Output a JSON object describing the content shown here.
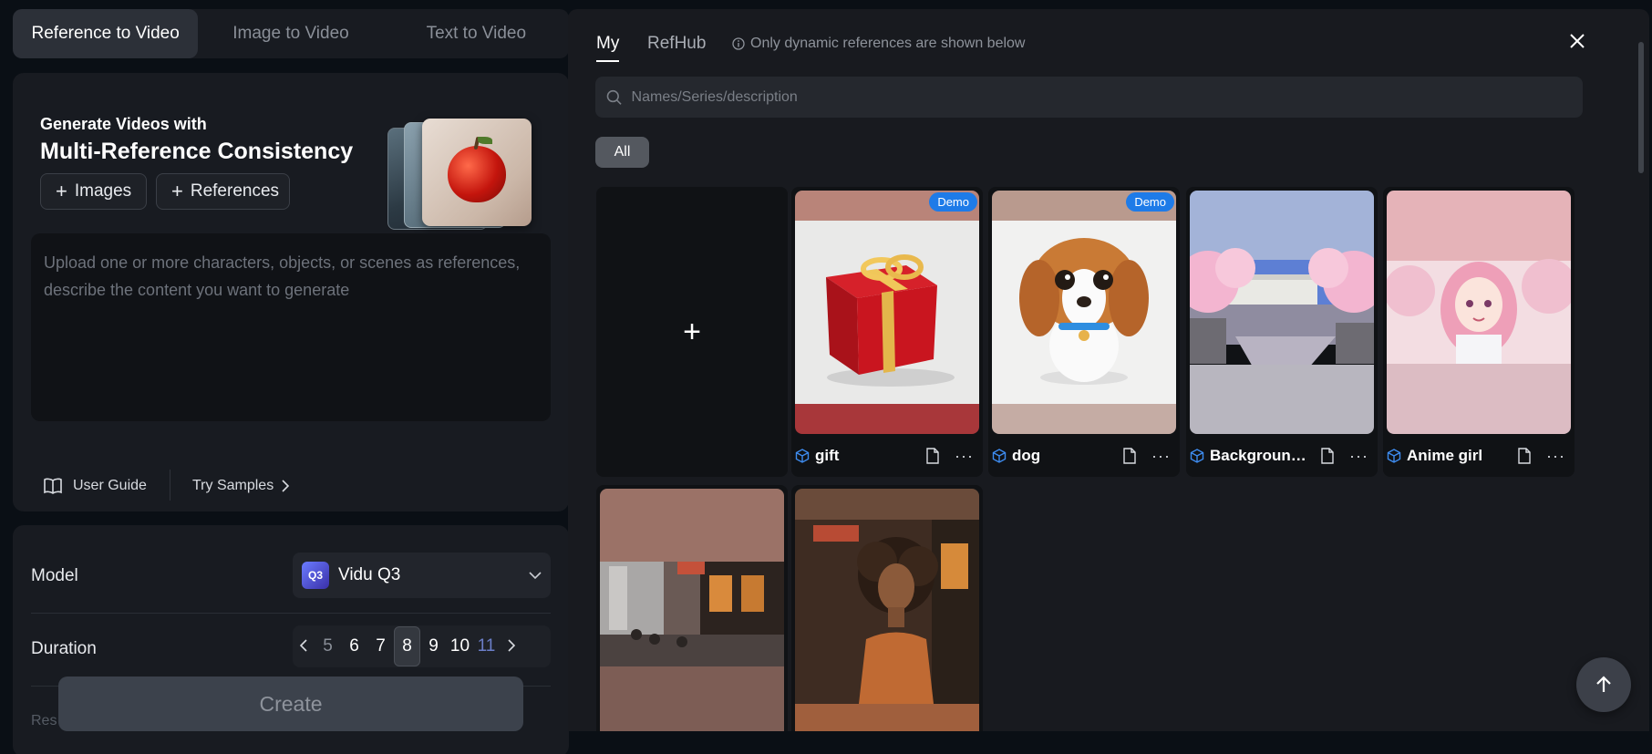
{
  "mode_tabs": [
    {
      "label": "Reference to Video",
      "active": true
    },
    {
      "label": "Image to Video",
      "active": false
    },
    {
      "label": "Text to Video",
      "active": false
    }
  ],
  "promo": {
    "subtitle": "Generate Videos with",
    "title": "Multi-Reference Consistency",
    "images_button": "Images",
    "references_button": "References"
  },
  "prompt": {
    "placeholder": "Upload one or more characters, objects, or scenes as references, describe the content you want to generate"
  },
  "links": {
    "user_guide": "User Guide",
    "try_samples": "Try Samples"
  },
  "settings": {
    "model_label": "Model",
    "model_badge": "Q3",
    "model_value": "Vidu Q3",
    "duration_label": "Duration",
    "duration_options": [
      "5",
      "6",
      "7",
      "8",
      "9",
      "10",
      "11"
    ],
    "duration_selected": "8",
    "next_label_partial": "Res"
  },
  "create_button": "Create",
  "drawer": {
    "tabs": [
      {
        "label": "My",
        "active": true
      },
      {
        "label": "RefHub",
        "active": false
      }
    ],
    "hint": "Only dynamic references are shown below",
    "search_placeholder": "Names/Series/description",
    "filter_all": "All",
    "add_symbol": "+",
    "demo_label": "Demo",
    "more_symbol": "···",
    "items": [
      {
        "name": "gift",
        "demo": true
      },
      {
        "name": "dog",
        "demo": true
      },
      {
        "name": "Background-h...",
        "demo": false
      },
      {
        "name": "Anime girl",
        "demo": false
      }
    ]
  },
  "icons": {
    "close": "close-icon",
    "search": "search-icon",
    "info": "info-icon",
    "book": "book-icon",
    "cube": "cube-icon",
    "document": "document-icon",
    "back_to_top": "arrow-up-icon"
  },
  "colors": {
    "accent_blue": "#1e7be8",
    "panel": "#181b21",
    "background": "#0a0f15"
  }
}
